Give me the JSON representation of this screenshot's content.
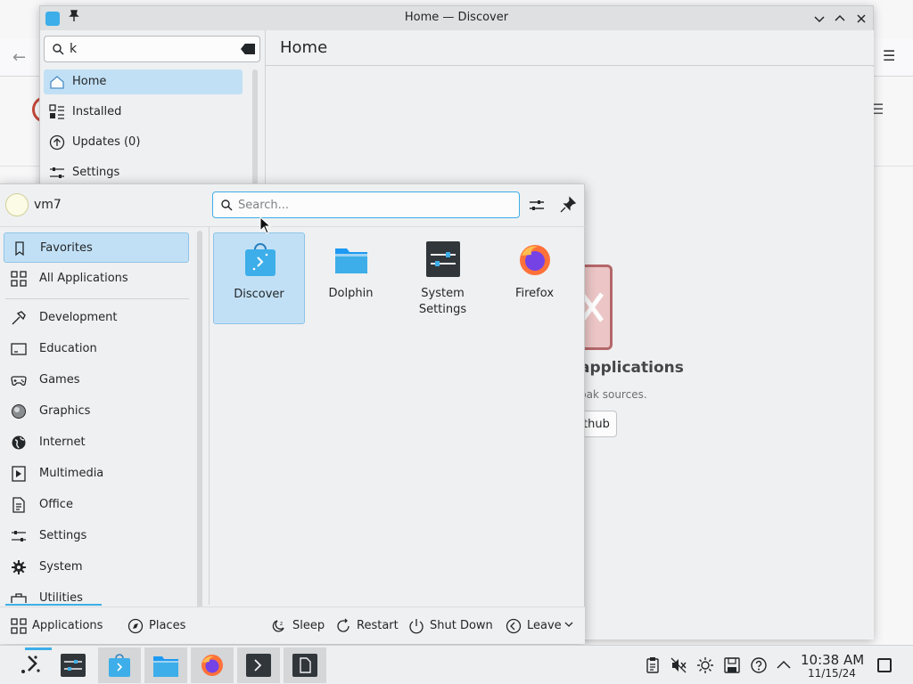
{
  "discover": {
    "title": "Home — Discover",
    "search_value": "k",
    "nav": [
      {
        "label": "Home",
        "icon": "home-icon",
        "active": true
      },
      {
        "label": "Installed",
        "icon": "installed-icon"
      },
      {
        "label": "Updates (0)",
        "icon": "updates-icon"
      },
      {
        "label": "Settings",
        "icon": "settings-icon"
      }
    ],
    "page_title": "Home",
    "placeholder_title_fragment": "applications",
    "placeholder_subtitle_fragment": "pak sources.",
    "placeholder_button_fragment": "thub"
  },
  "launcher": {
    "username": "vm7",
    "search_placeholder": "Search...",
    "categories": [
      {
        "label": "Favorites",
        "icon": "favorites-icon",
        "active": true
      },
      {
        "label": "All Applications",
        "icon": "grid-icon"
      },
      {
        "label": "Development",
        "icon": "hammer-icon"
      },
      {
        "label": "Education",
        "icon": "education-icon"
      },
      {
        "label": "Games",
        "icon": "gamepad-icon"
      },
      {
        "label": "Graphics",
        "icon": "graphics-icon"
      },
      {
        "label": "Internet",
        "icon": "globe-icon"
      },
      {
        "label": "Multimedia",
        "icon": "multimedia-icon"
      },
      {
        "label": "Office",
        "icon": "office-icon"
      },
      {
        "label": "Settings",
        "icon": "sliders-icon"
      },
      {
        "label": "System",
        "icon": "gear-icon"
      },
      {
        "label": "Utilities",
        "icon": "utilities-icon"
      }
    ],
    "favorites": [
      {
        "label": "Discover",
        "icon": "discover-icon",
        "active": true
      },
      {
        "label": "Dolphin",
        "icon": "dolphin-icon"
      },
      {
        "label": "System Settings",
        "icon": "system-settings-icon"
      },
      {
        "label": "Firefox",
        "icon": "firefox-icon"
      }
    ],
    "footer": {
      "applications": "Applications",
      "places": "Places",
      "sleep": "Sleep",
      "restart": "Restart",
      "shutdown": "Shut Down",
      "leave": "Leave"
    }
  },
  "taskbar": {
    "time": "10:38 AM",
    "date": "11/15/24"
  },
  "colors": {
    "accent": "#3daee9",
    "selection": "#c2e0f5",
    "panel": "#eff0f1"
  }
}
